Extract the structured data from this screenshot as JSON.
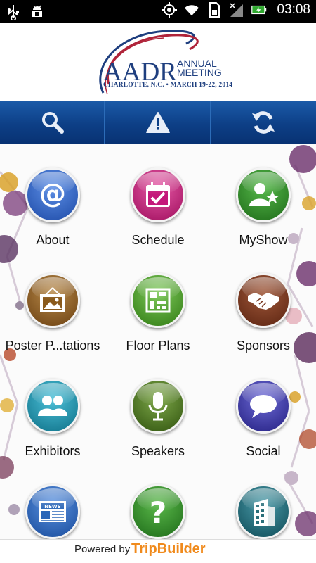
{
  "status_bar": {
    "time": "03:08",
    "left_icons": [
      "usb-icon",
      "android-debug-icon"
    ],
    "right_icons": [
      "gps-icon",
      "wifi-icon",
      "sd-card-icon",
      "signal-icon",
      "battery-icon"
    ]
  },
  "header": {
    "logo_main": "AADR",
    "logo_annual": "ANNUAL",
    "logo_meeting": "MEETING",
    "logo_sub": "CHARLOTTE, N.C. • MARCH 19-22, 2014",
    "colors": {
      "navy": "#1f3f7f",
      "red": "#b0243a"
    }
  },
  "toolbar": {
    "buttons": [
      {
        "icon": "search-icon"
      },
      {
        "icon": "alert-icon"
      },
      {
        "icon": "refresh-icon"
      }
    ],
    "color": "#0d3f86"
  },
  "menu": {
    "items": [
      {
        "label": "About",
        "icon": "at-icon",
        "color": "#2f64c9"
      },
      {
        "label": "Schedule",
        "icon": "calendar-icon",
        "color": "#c4187a"
      },
      {
        "label": "MyShow",
        "icon": "person-star-icon",
        "color": "#2f8a2a"
      },
      {
        "label": "Poster P...tations",
        "icon": "picture-frame-icon",
        "color": "#8a5a1c"
      },
      {
        "label": "Floor Plans",
        "icon": "floor-plan-icon",
        "color": "#4f9c2a"
      },
      {
        "label": "Sponsors",
        "icon": "handshake-icon",
        "color": "#7a3a22"
      },
      {
        "label": "Exhibitors",
        "icon": "people-icon",
        "color": "#1d9ab3"
      },
      {
        "label": "Speakers",
        "icon": "microphone-icon",
        "color": "#4d7a1d"
      },
      {
        "label": "Social",
        "icon": "chat-bubble-icon",
        "color": "#3d3aa0"
      },
      {
        "label": "",
        "icon": "news-icon",
        "color": "#2a66b8"
      },
      {
        "label": "",
        "icon": "question-icon",
        "color": "#2f8a2a"
      },
      {
        "label": "",
        "icon": "building-icon",
        "color": "#2a6f7a"
      }
    ]
  },
  "footer": {
    "powered_by": "Powered by",
    "brand": "TripBuilder"
  }
}
